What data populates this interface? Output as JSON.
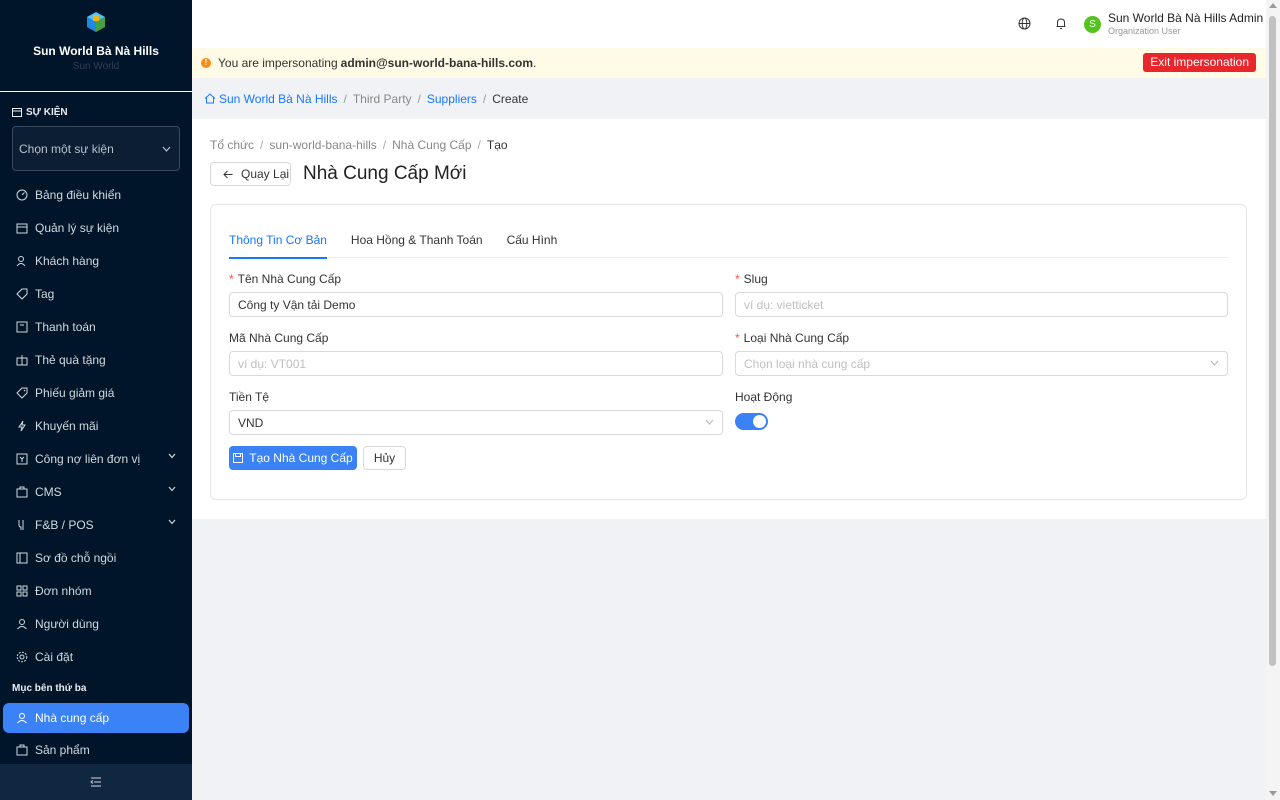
{
  "brand": {
    "name": "Sun World Bà Nà Hills",
    "subtitle": "Sun World"
  },
  "sidebar": {
    "event_section_label": "SỰ KIỆN",
    "event_select_placeholder": "Chọn một sự kiện",
    "items": [
      {
        "label": "Bảng điều khiển",
        "icon": "dashboard-icon"
      },
      {
        "label": "Quản lý sự kiện",
        "icon": "calendar-icon"
      },
      {
        "label": "Khách hàng",
        "icon": "customers-icon"
      },
      {
        "label": "Tag",
        "icon": "tag-icon"
      },
      {
        "label": "Thanh toán",
        "icon": "payment-icon"
      },
      {
        "label": "Thẻ quà tặng",
        "icon": "gift-icon"
      },
      {
        "label": "Phiếu giảm giá",
        "icon": "coupon-icon"
      },
      {
        "label": "Khuyến mãi",
        "icon": "promotion-icon"
      },
      {
        "label": "Công nợ liên đơn vị",
        "icon": "debt-icon",
        "expandable": true
      },
      {
        "label": "CMS",
        "icon": "cms-icon",
        "expandable": true
      },
      {
        "label": "F&B / POS",
        "icon": "fnb-icon",
        "expandable": true
      },
      {
        "label": "Sơ đồ chỗ ngồi",
        "icon": "seatmap-icon"
      },
      {
        "label": "Đơn nhóm",
        "icon": "group-order-icon"
      },
      {
        "label": "Người dùng",
        "icon": "user-icon"
      },
      {
        "label": "Cài đặt",
        "icon": "settings-icon"
      }
    ],
    "third_party_section": "Mục bên thứ ba",
    "third_party_items": [
      {
        "label": "Nhà cung cấp",
        "icon": "user-icon",
        "active": true
      },
      {
        "label": "Sản phẩm",
        "icon": "product-icon"
      }
    ]
  },
  "topbar": {
    "user_name": "Sun World Bà Nà Hills Admin",
    "user_role": "Organization User",
    "avatar_letter": "S"
  },
  "impersonation": {
    "text": "You are impersonating",
    "email": "admin@sun-world-bana-hills.com",
    "suffix": ".",
    "exit_label": "Exit impersonation"
  },
  "breadcrumb_top": {
    "home": "Sun World Bà Nà Hills",
    "third_party": "Third Party",
    "suppliers": "Suppliers",
    "current": "Create"
  },
  "breadcrumb_page": {
    "org": "Tổ chức",
    "slug": "sun-world-bana-hills",
    "section": "Nhà Cung Cấp",
    "current": "Tạo"
  },
  "page": {
    "back_label": "Quay Lại",
    "title": "Nhà Cung Cấp Mới"
  },
  "tabs": [
    "Thông Tin Cơ Bản",
    "Hoa Hồng & Thanh Toán",
    "Cấu Hình"
  ],
  "form": {
    "name_label": "Tên Nhà Cung Cấp",
    "name_value": "Công ty Vận tải Demo",
    "slug_label": "Slug",
    "slug_placeholder": "ví dụ: vietticket",
    "code_label": "Mã Nhà Cung Cấp",
    "code_placeholder": "ví dụ: VT001",
    "type_label": "Loại Nhà Cung Cấp",
    "type_placeholder": "Chọn loại nhà cung cấp",
    "currency_label": "Tiền Tệ",
    "currency_value": "VND",
    "active_label": "Hoạt Động",
    "active_value": true,
    "submit_label": "Tạo Nhà Cung Cấp",
    "cancel_label": "Hủy"
  },
  "colors": {
    "sidebar_bg": "#001529",
    "primary": "#3b82f6",
    "danger": "#e8262b",
    "link": "#1677ff",
    "warning_bg": "#fffbe6"
  }
}
